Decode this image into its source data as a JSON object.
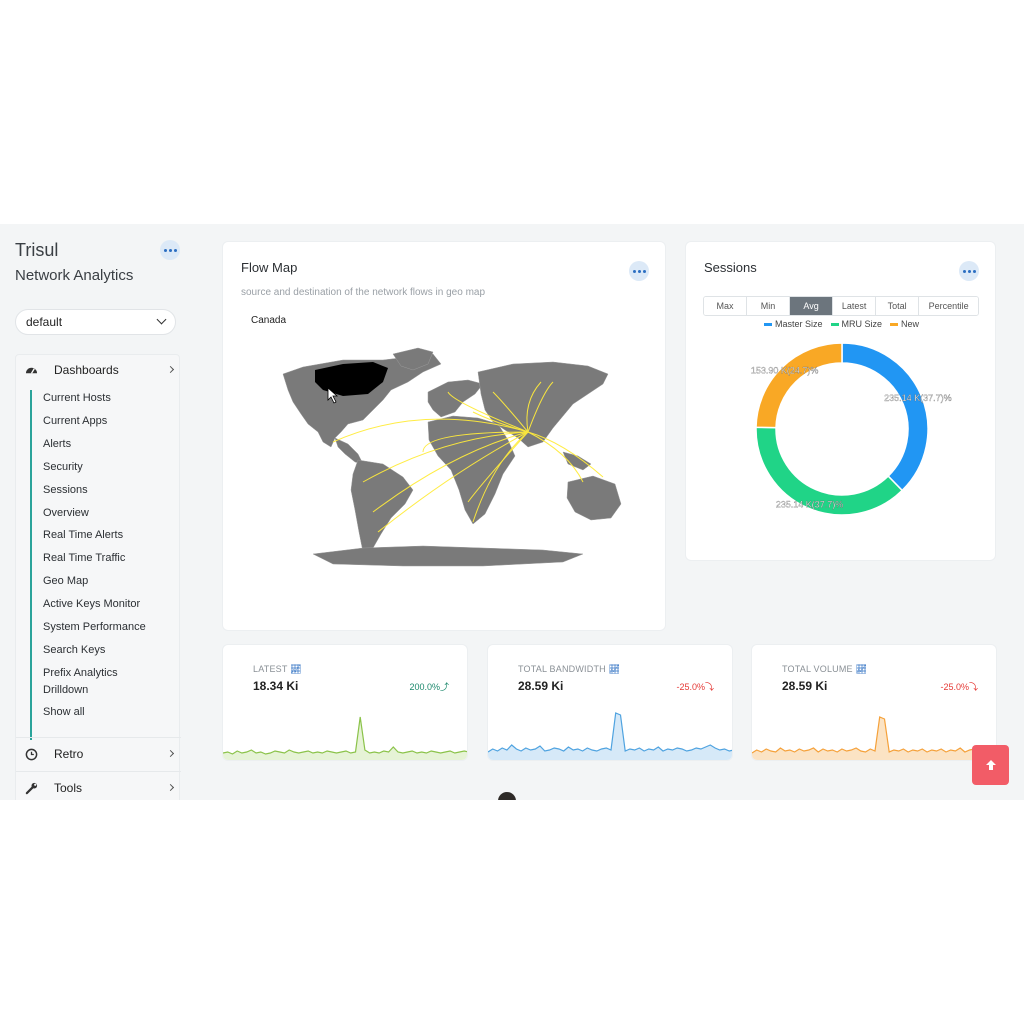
{
  "brand": {
    "title": "Trisul",
    "subtitle": "Network Analytics"
  },
  "context_select": {
    "value": "default"
  },
  "sidebar": {
    "dashboards": {
      "label": "Dashboards",
      "items": [
        "Current Hosts",
        "Current Apps",
        "Alerts",
        "Security",
        "Sessions",
        "Overview",
        "Real Time Alerts",
        "Real Time Traffic",
        "Geo Map",
        "Active Keys Monitor",
        "System Performance",
        "Search Keys",
        "Prefix Analytics Drilldown",
        "Show all"
      ]
    },
    "retro": {
      "label": "Retro"
    },
    "tools": {
      "label": "Tools"
    }
  },
  "flow_map": {
    "title": "Flow Map",
    "subtitle": "source and destination of the network flows in geo map",
    "hover_label": "Canada"
  },
  "sessions": {
    "title": "Sessions",
    "tabs": [
      "Max",
      "Min",
      "Avg",
      "Latest",
      "Total",
      "Percentile"
    ],
    "active_tab": "Avg",
    "chart_data": {
      "type": "pie",
      "categories": [
        "Master Size",
        "MRU Size",
        "New"
      ],
      "values": [
        37.7,
        37.7,
        24.7
      ],
      "data_labels": [
        "235.14 K(37.7)%",
        "235.14 K(37.7)%",
        "153.90 K(24.7)%"
      ],
      "legend_position": "top",
      "colors": [
        "#2196f3",
        "#20d487",
        "#f9a825"
      ]
    }
  },
  "kpis": [
    {
      "label": "LATEST",
      "value": "18.34 Ki",
      "delta": "200.0%",
      "delta_color": "#1e8a6e",
      "line": "#8bc34a",
      "fill": "#e6f3d6"
    },
    {
      "label": "TOTAL BANDWIDTH",
      "value": "28.59 Ki",
      "delta": "-25.0%",
      "delta_color": "#e53935",
      "line": "#4fa3e0",
      "fill": "#d6e9f8"
    },
    {
      "label": "TOTAL VOLUME",
      "value": "28.59 Ki",
      "delta": "-25.0%",
      "delta_color": "#e53935",
      "line": "#f5a13a",
      "fill": "#fbe3c4"
    }
  ],
  "colors": {
    "accent": "#2aa39a",
    "fab": "#f25c67",
    "map_land": "#777777",
    "flow_lines": "#ffeb3b"
  }
}
